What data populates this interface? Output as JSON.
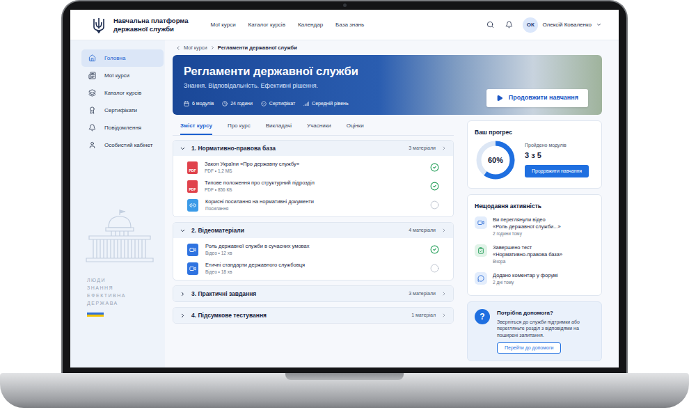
{
  "app": {
    "title": [
      "Навчальна платформа",
      "державної служби"
    ]
  },
  "nav": [
    "Мої курси",
    "Каталог курсів",
    "Календар",
    "База знань"
  ],
  "user": {
    "initials": "ОК",
    "name": "Олексій Коваленко"
  },
  "sidebar": {
    "items": [
      {
        "label": "Головна",
        "selected": true
      },
      {
        "label": "Мої курси",
        "selected": false
      },
      {
        "label": "Каталог курсів",
        "selected": false
      },
      {
        "label": "Сертифікати",
        "selected": false
      },
      {
        "label": "Повідомлення",
        "selected": false
      },
      {
        "label": "Особистий кабінет",
        "selected": false
      }
    ],
    "motto": [
      "ЛЮДИ",
      "ЗНАННЯ",
      "ЕФЕКТИВНА",
      "ДЕРЖАВА"
    ]
  },
  "breadcrumb": [
    "Мої курси",
    "Регламенти державної служби"
  ],
  "banner": {
    "title": "Регламенти державної служби",
    "subtitle": "Знання. Відповідальність. Ефективні рішення.",
    "meta": [
      "6 модулів",
      "24 години",
      "Сертифікат",
      "Середній рівень"
    ],
    "button": "Продовжити навчання"
  },
  "tabs": [
    {
      "label": "Зміст курсу",
      "selected": true
    },
    {
      "label": "Про курс",
      "selected": false
    },
    {
      "label": "Викладачі",
      "selected": false
    },
    {
      "label": "Учасники",
      "selected": false
    },
    {
      "label": "Оцінки",
      "selected": false
    }
  ],
  "modules": [
    {
      "title": "1. Нормативно-правова база",
      "count": "3 матеріали",
      "expanded": true,
      "items": [
        {
          "kind": "pdf",
          "icon_label": "PDF",
          "title": "Закон України «Про державну службу»",
          "meta": "PDF • 1,2 МБ",
          "checked": true
        },
        {
          "kind": "pdf",
          "icon_label": "PDF",
          "title": "Типове положення про структурний підрозділ",
          "meta": "PDF • 856 КБ",
          "checked": true
        },
        {
          "kind": "link",
          "title": "Корисні посилання на нормативні документи",
          "meta": "Посилання",
          "checked": false
        }
      ]
    },
    {
      "title": "2. Відеоматеріали",
      "count": "4 матеріали",
      "expanded": true,
      "items": [
        {
          "kind": "video",
          "title": "Роль державної служби в сучасних умовах",
          "meta": "Відео • 12 хв",
          "checked": true
        },
        {
          "kind": "video",
          "title": "Етичні стандарти державного службовця",
          "meta": "Відео • 18 хв",
          "checked": false
        }
      ]
    },
    {
      "title": "3. Практичні завдання",
      "count": "3 матеріали",
      "expanded": false,
      "items": []
    },
    {
      "title": "4. Підсумкове тестування",
      "count": "1 матеріал",
      "expanded": false,
      "items": []
    }
  ],
  "progress": {
    "title": "Ваш прогрес",
    "percent": "60%",
    "level": 0.6,
    "label": "Пройдено модулів",
    "value": "3 з 5",
    "button": "Продовжити навчання"
  },
  "activity": {
    "title": "Нещодавня активність",
    "items": [
      {
        "kind": "video",
        "lines": [
          "Ви переглянули відео",
          "«Роль державної служби...»"
        ],
        "time": "2 години тому"
      },
      {
        "kind": "test",
        "lines": [
          "Завершено тест",
          "«Нормативно-правова база»"
        ],
        "time": "Вчора"
      },
      {
        "kind": "comment",
        "lines": [
          "Додано коментар у форумі"
        ],
        "time": "2 дні тому"
      }
    ]
  },
  "help": {
    "icon": "?",
    "title": "Потрібна допомога?",
    "text": "Зверніться до служби підтримки або перегляньте розділ з відповідями на поширені запитання.",
    "button": "Перейти до допомоги"
  }
}
